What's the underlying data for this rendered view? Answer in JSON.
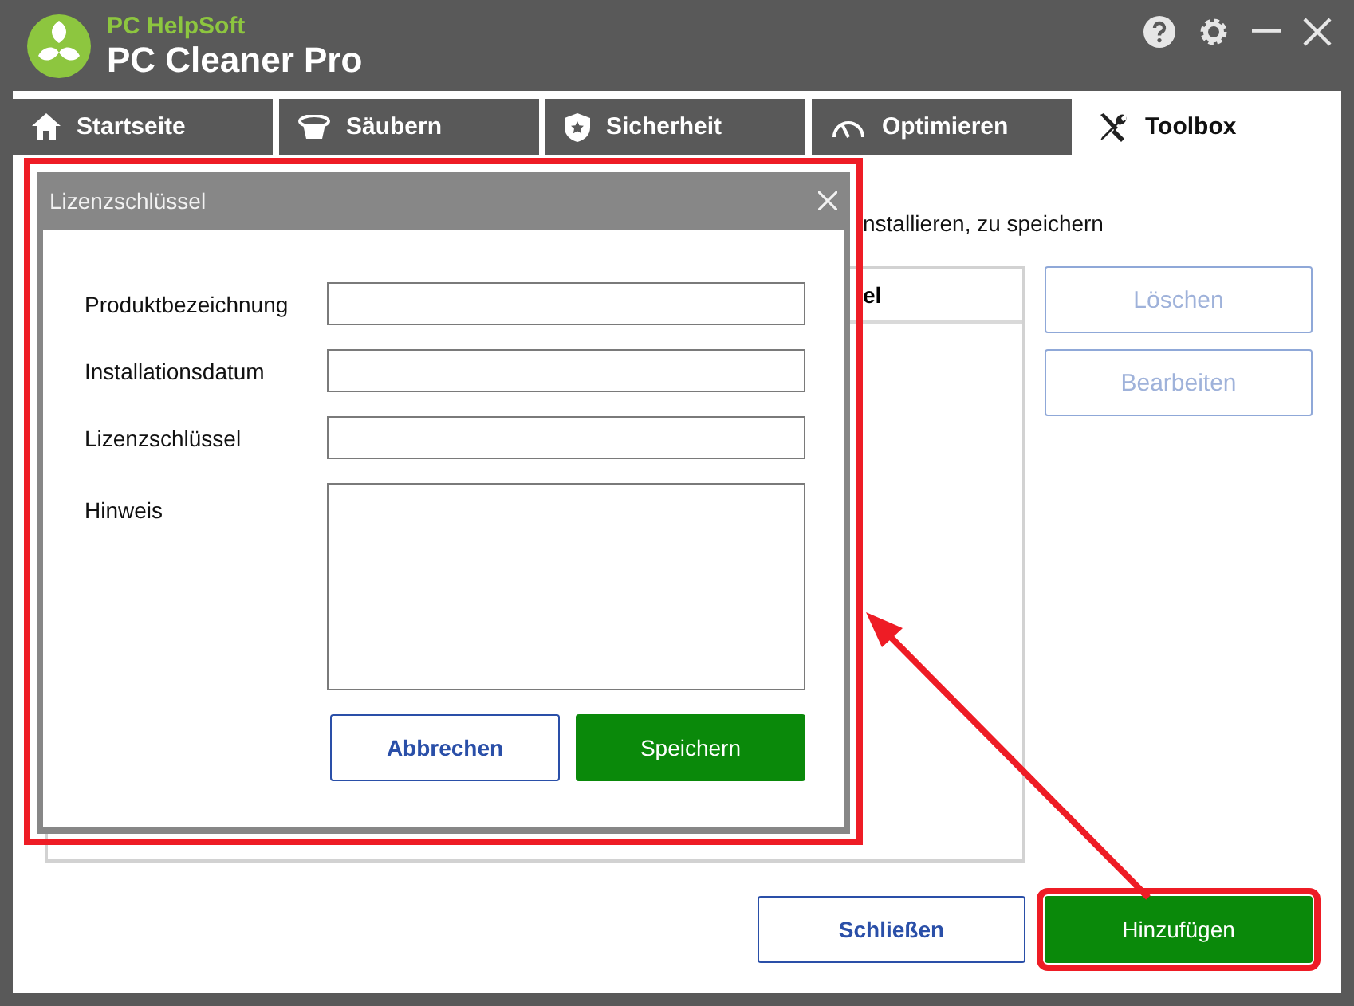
{
  "app": {
    "vendor": "PC HelpSoft",
    "name": "PC Cleaner Pro"
  },
  "tabs": [
    {
      "label": "Startseite",
      "selected": false
    },
    {
      "label": "Säubern",
      "selected": false
    },
    {
      "label": "Sicherheit",
      "selected": false
    },
    {
      "label": "Optimieren",
      "selected": false
    },
    {
      "label": "Toolbox",
      "selected": true
    }
  ],
  "description": "nstallieren, zu speichern",
  "table": {
    "columns": [
      "el"
    ]
  },
  "side_buttons": [
    {
      "label": "Löschen",
      "disabled": true
    },
    {
      "label": "Bearbeiten",
      "disabled": true
    }
  ],
  "footer_buttons": [
    {
      "label": "Schließen",
      "kind": "secondary",
      "highlighted": false
    },
    {
      "label": "Hinzufügen",
      "kind": "primary",
      "highlighted": true
    }
  ],
  "dialog": {
    "title": "Lizenzschlüssel",
    "highlighted": true,
    "fields": [
      {
        "label": "Produktbezeichnung",
        "kind": "line"
      },
      {
        "label": "Installationsdatum",
        "kind": "line"
      },
      {
        "label": "Lizenzschlüssel",
        "kind": "line"
      },
      {
        "label": "Hinweis",
        "kind": "multiline"
      }
    ],
    "buttons": [
      {
        "label": "Abbrechen",
        "kind": "secondary"
      },
      {
        "label": "Speichern",
        "kind": "primary"
      }
    ]
  }
}
